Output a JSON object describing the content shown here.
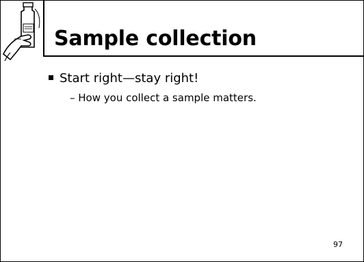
{
  "slide": {
    "title": "Sample collection",
    "bullets": [
      {
        "text": "Start right—stay right!"
      },
      {
        "text": "– How you collect a sample matters."
      }
    ],
    "page_number": "97"
  }
}
